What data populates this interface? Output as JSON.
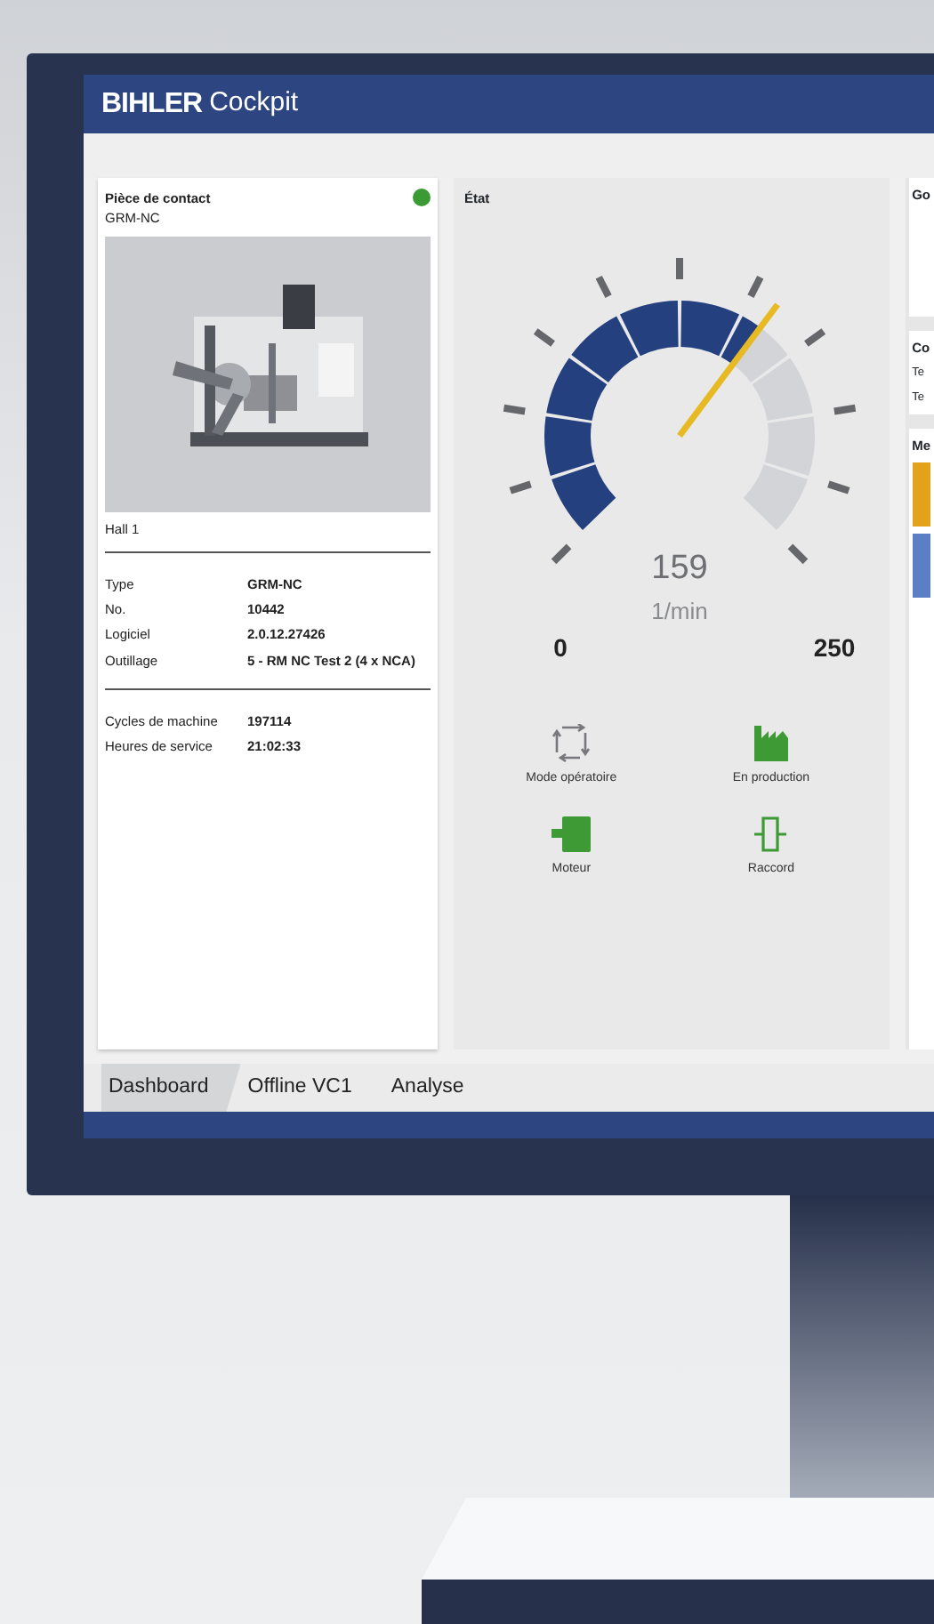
{
  "app": {
    "logo": "BIHLER",
    "title": "Cockpit"
  },
  "contact_card": {
    "title": "Pièce de contact",
    "subtitle": "GRM-NC",
    "connected": true,
    "location": "Hall 1",
    "details": [
      {
        "label": "Type",
        "value": "GRM-NC"
      },
      {
        "label": "No.",
        "value": "10442"
      },
      {
        "label": "Logiciel",
        "value": "2.0.12.27426"
      },
      {
        "label": "Outillage",
        "value": "5 - RM NC Test 2 (4 x NCA)"
      }
    ],
    "counters": [
      {
        "label": "Cycles de machine",
        "value": "197114"
      },
      {
        "label": "Heures de service",
        "value": "21:02:33"
      }
    ]
  },
  "state_panel": {
    "title": "État",
    "gauge": {
      "level": 0.636,
      "value": "159",
      "unit": "1/min",
      "min": "0",
      "max": "250"
    },
    "indicators": [
      {
        "label": "Mode opératoire",
        "kind": "cycle",
        "active": false
      },
      {
        "label": "En production",
        "kind": "factory",
        "active": true
      },
      {
        "label": "Moteur",
        "kind": "motor",
        "active": true
      },
      {
        "label": "Raccord",
        "kind": "coupling",
        "active": true
      }
    ]
  },
  "right_panel": {
    "sections": [
      {
        "heading": "Go"
      },
      {
        "heading": "Co",
        "rows": [
          "Te",
          "Te"
        ]
      },
      {
        "heading": "Me",
        "messages": [
          {
            "kind": "warning"
          },
          {
            "kind": "info"
          }
        ]
      }
    ]
  },
  "tabs": [
    {
      "label": "Dashboard",
      "selected": true
    },
    {
      "label": "Offline VC1",
      "selected": false
    },
    {
      "label": "Analyse",
      "selected": false
    }
  ]
}
